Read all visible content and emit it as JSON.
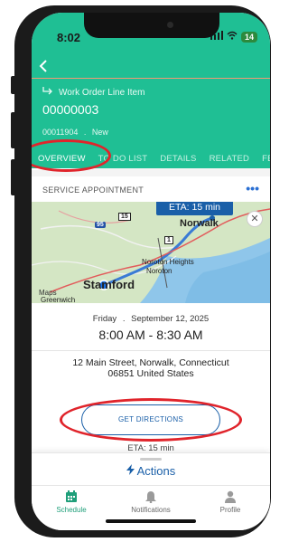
{
  "status_bar": {
    "time": "8:02",
    "battery": "14"
  },
  "header": {
    "record_type": "Work Order Line Item",
    "record_number": "00000003",
    "parent_number": "00011904",
    "separator": ".",
    "status": "New"
  },
  "tabs": [
    {
      "label": "OVERVIEW",
      "active": true
    },
    {
      "label": "TO DO LIST",
      "active": false
    },
    {
      "label": "DETAILS",
      "active": false
    },
    {
      "label": "RELATED",
      "active": false
    },
    {
      "label": "FEED",
      "active": false
    }
  ],
  "service_appointment": {
    "section_title": "SERVICE APPOINTMENT",
    "more_icon": "more-dots-icon",
    "map": {
      "eta_badge": "ETA: 15 min",
      "labels": {
        "norwalk": "Norwalk",
        "noroton_heights": "Noroton Heights",
        "noroton": "Noroton",
        "stamford": "Stamford",
        "greenwich": "Greenwich",
        "maps": "Maps",
        "route_95": "95",
        "route_15": "15",
        "route_1": "1"
      }
    },
    "date_day": "Friday",
    "date_sep": ".",
    "date": "September 12, 2025",
    "time_range": "8:00 AM - 8:30 AM",
    "address_line1": "12 Main Street, Norwalk, Connecticut",
    "address_line2": "06851 United States",
    "directions_button": "GET DIRECTIONS",
    "eta_footer": "ETA: 15 min"
  },
  "actions_label": "Actions",
  "bottom_nav": [
    {
      "label": "Schedule",
      "icon": "calendar-icon",
      "active": true
    },
    {
      "label": "Notifications",
      "icon": "bell-icon",
      "active": false
    },
    {
      "label": "Profile",
      "icon": "person-icon",
      "active": false
    }
  ],
  "colors": {
    "header": "#1fbf94",
    "accent_blue": "#1a5fa8",
    "annotation_red": "#e0242b"
  }
}
